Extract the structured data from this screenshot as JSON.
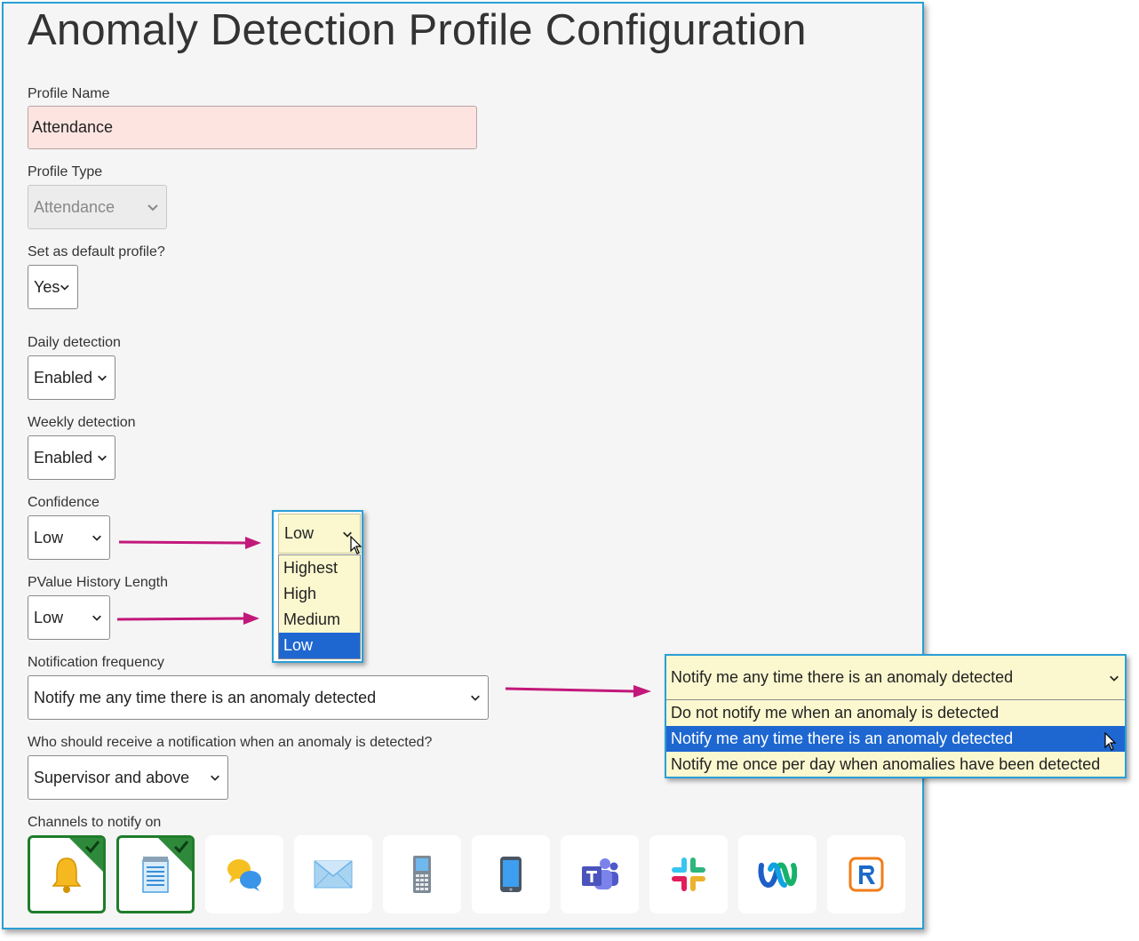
{
  "title": "Anomaly Detection Profile Configuration",
  "fields": {
    "profile_name": {
      "label": "Profile Name",
      "value": "Attendance"
    },
    "profile_type": {
      "label": "Profile Type",
      "value": "Attendance"
    },
    "default_profile": {
      "label": "Set as default profile?",
      "value": "Yes"
    },
    "daily_detection": {
      "label": "Daily detection",
      "value": "Enabled"
    },
    "weekly_detection": {
      "label": "Weekly detection",
      "value": "Enabled"
    },
    "confidence": {
      "label": "Confidence",
      "value": "Low"
    },
    "pvalue_history": {
      "label": "PValue History Length",
      "value": "Low"
    },
    "notification_frequency": {
      "label": "Notification frequency",
      "value": "Notify me any time there is an anomaly detected"
    },
    "recipients": {
      "label": "Who should receive a notification when an anomaly is detected?",
      "value": "Supervisor and above"
    },
    "channels": {
      "label": "Channels to notify on"
    }
  },
  "confidence_dropdown": {
    "selected": "Low",
    "options": [
      "Highest",
      "High",
      "Medium",
      "Low"
    ]
  },
  "notification_dropdown": {
    "selected": "Notify me any time there is an anomaly detected",
    "options": [
      "Do not notify me when an anomaly is detected",
      "Notify me any time there is an anomaly detected",
      "Notify me once per day when anomalies have been detected"
    ]
  },
  "channels": [
    {
      "icon": "bell-icon",
      "active": true
    },
    {
      "icon": "notepad-icon",
      "active": true
    },
    {
      "icon": "chat-bubbles-icon",
      "active": false
    },
    {
      "icon": "envelope-icon",
      "active": false
    },
    {
      "icon": "feature-phone-icon",
      "active": false
    },
    {
      "icon": "smartphone-icon",
      "active": false
    },
    {
      "icon": "teams-icon",
      "active": false
    },
    {
      "icon": "slack-icon",
      "active": false
    },
    {
      "icon": "webex-icon",
      "active": false
    },
    {
      "icon": "r-app-icon",
      "active": false
    }
  ],
  "colors": {
    "panel_border": "#2a9fd6",
    "arrow": "#c2187a",
    "selected_option": "#1e67d1",
    "active_channel": "#1f7d2b",
    "popout_bg": "#fbf8cf",
    "name_input_bg": "#fde4e1"
  }
}
